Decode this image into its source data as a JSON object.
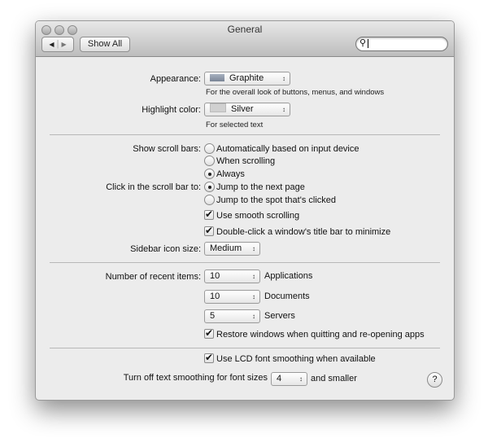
{
  "window": {
    "title": "General",
    "show_all": "Show All",
    "search_placeholder": ""
  },
  "appearance": {
    "label": "Appearance:",
    "value": "Graphite",
    "hint": "For the overall look of buttons, menus, and windows",
    "swatch": "#8d98a8"
  },
  "highlight": {
    "label": "Highlight color:",
    "value": "Silver",
    "hint": "For selected text",
    "swatch": "#d0d0d0"
  },
  "scrollbars": {
    "label": "Show scroll bars:",
    "options": [
      "Automatically based on input device",
      "When scrolling",
      "Always"
    ],
    "selected": 2
  },
  "click_scroll": {
    "label": "Click in the scroll bar to:",
    "options": [
      "Jump to the next page",
      "Jump to the spot that's clicked"
    ],
    "selected": 0
  },
  "smooth_scrolling": {
    "label": "Use smooth scrolling",
    "checked": true
  },
  "double_click": {
    "label": "Double-click a window's title bar to minimize",
    "checked": true
  },
  "sidebar": {
    "label": "Sidebar icon size:",
    "value": "Medium"
  },
  "recent": {
    "label": "Number of recent items:",
    "rows": [
      {
        "value": "10",
        "label": "Applications"
      },
      {
        "value": "10",
        "label": "Documents"
      },
      {
        "value": "5",
        "label": "Servers"
      }
    ]
  },
  "restore_windows": {
    "label": "Restore windows when quitting and re-opening apps",
    "checked": true
  },
  "lcd": {
    "label": "Use LCD font smoothing when available",
    "checked": true
  },
  "font_smoothing": {
    "label": "Turn off text smoothing for font sizes",
    "value": "4",
    "suffix": "and smaller"
  },
  "help": "?"
}
